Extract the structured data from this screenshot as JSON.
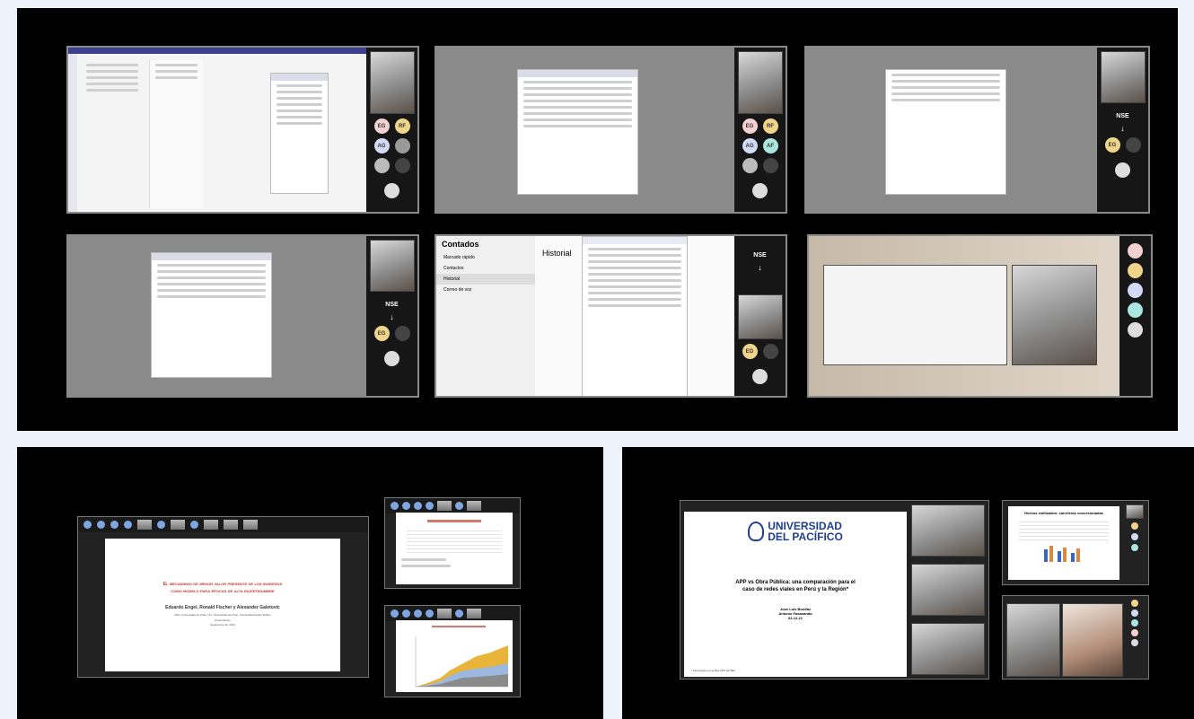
{
  "colors": {
    "background": "#eef3fb",
    "panel": "#000000",
    "teams_purple": "#5b5fc7",
    "chart_gold": "#e8b53a",
    "chart_blue": "#9db8e0",
    "slide_red": "#c0392b",
    "upacifico_blue": "#1f3f8f"
  },
  "top_panel": {
    "participant_tags": {
      "a": "NSE",
      "b": "RM"
    },
    "contacts_screen": {
      "title": "Contados",
      "menu": [
        "Marcado rápido",
        "Contactos",
        "Historial",
        "Correo de voz"
      ],
      "history_title": "Historial"
    }
  },
  "slide_left": {
    "title_line1": "El mecanismo de menor valor presente de los ingresos",
    "title_line2": "como modelo para épocas de alta incertidumbre",
    "authors": "Eduardo Engel, Ronald Fischer y Alexander Galetovic",
    "affiliation": "FEN, Universidad de Chile; UC; Universidad de Chile; Universidad Adolfo Ibáñez",
    "event": "Presentación",
    "date": "Septiembre 30, 2021"
  },
  "slide_right": {
    "university_line1": "UNIVERSIDAD",
    "university_line2": "DEL PACÍFICO",
    "title_line1": "APP vs Obra Pública: una comparación para el",
    "title_line2": "caso de redes viales en Perú y la Región*",
    "author1": "José Luis Bonifaz",
    "author2": "Antonio Fasanando",
    "date": "02-12-21",
    "footnote": "* Financiado por la Red APP del BID",
    "side_slide_title": "Hechos estilizados: carreteras concesionadas"
  }
}
